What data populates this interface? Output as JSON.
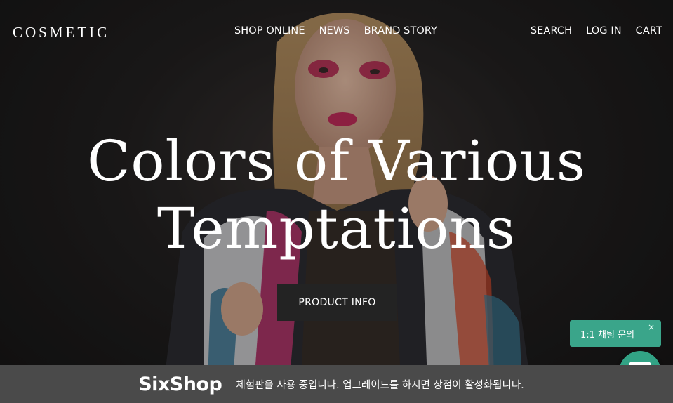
{
  "header": {
    "logo": "COSMETIC",
    "nav_center": [
      "SHOP ONLINE",
      "NEWS",
      "BRAND STORY"
    ],
    "nav_right": [
      "SEARCH",
      "LOG IN",
      "CART"
    ]
  },
  "hero": {
    "headline_line1": "Colors of Various",
    "headline_line2": "Temptations",
    "cta_label": "PRODUCT INFO"
  },
  "chat": {
    "bubble_text": "1:1 채팅 문의",
    "close_glyph": "×",
    "accent": "#3aa58a"
  },
  "banner": {
    "logo": "SixShop",
    "message": "체험판을 사용 중입니다. 업그레이드를 하시면 상점이 활성화됩니다."
  }
}
